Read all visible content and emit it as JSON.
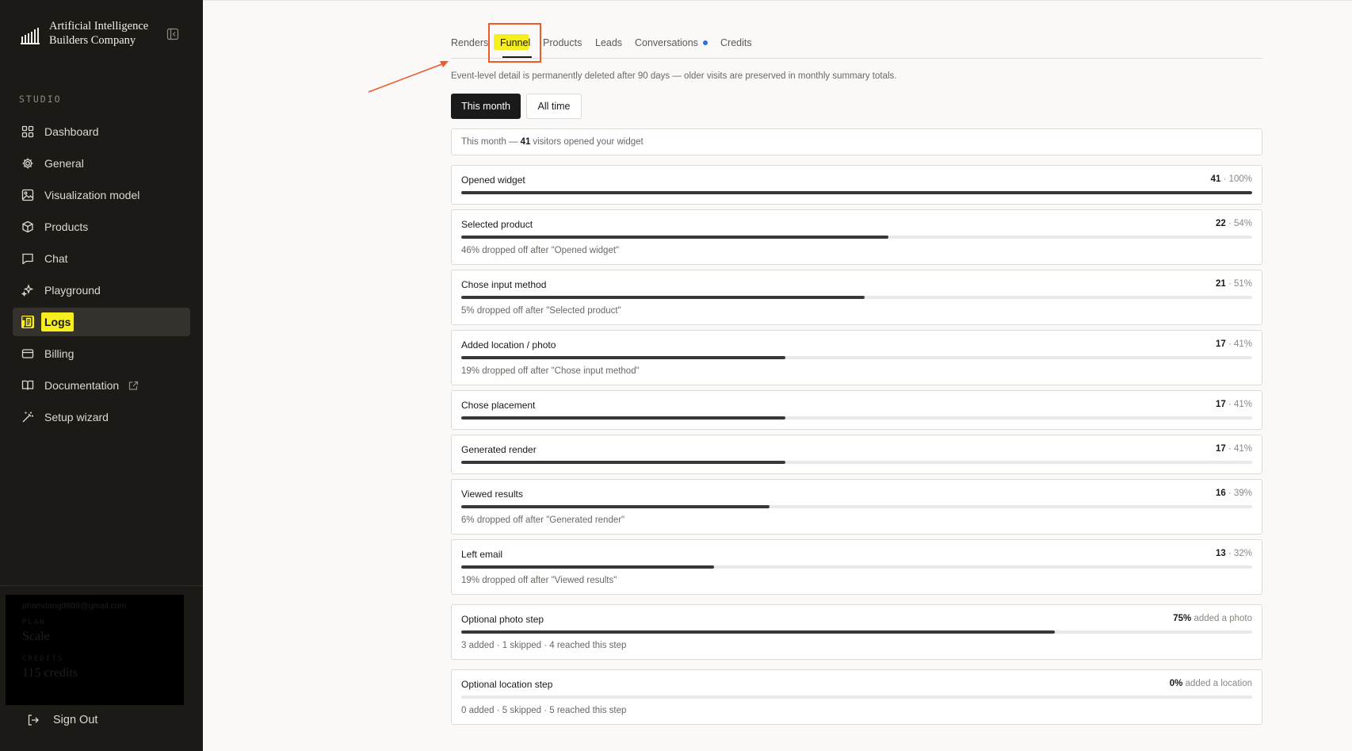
{
  "brand": {
    "line1": "Artificial Intelligence",
    "line2": "Builders Company"
  },
  "sidebar": {
    "section": "STUDIO",
    "items": [
      {
        "label": "Dashboard",
        "icon": "grid-icon"
      },
      {
        "label": "General",
        "icon": "gear-icon"
      },
      {
        "label": "Visualization model",
        "icon": "image-icon"
      },
      {
        "label": "Products",
        "icon": "box-icon"
      },
      {
        "label": "Chat",
        "icon": "chat-icon"
      },
      {
        "label": "Playground",
        "icon": "sparkle-icon"
      },
      {
        "label": "Logs",
        "icon": "scroll-icon",
        "active": true
      },
      {
        "label": "Billing",
        "icon": "card-icon"
      },
      {
        "label": "Documentation",
        "icon": "book-icon",
        "external": true
      },
      {
        "label": "Setup wizard",
        "icon": "wand-icon"
      }
    ],
    "account": {
      "email": "phamdang9809@gmail.com",
      "plan_label": "PLAN",
      "plan": "Scale",
      "credits_label": "CREDITS",
      "credits": "115 credits"
    },
    "signout": "Sign Out"
  },
  "tabs": [
    "Renders",
    "Funnel",
    "Products",
    "Leads",
    "Conversations",
    "Credits"
  ],
  "active_tab": "Funnel",
  "notice": "Event-level detail is permanently deleted after 90 days — older visits are preserved in monthly summary totals.",
  "range": {
    "this_month": "This month",
    "all_time": "All time",
    "selected": "This month"
  },
  "summary": {
    "prefix": "This month —",
    "count": "41",
    "suffix": "visitors opened your widget"
  },
  "steps": [
    {
      "title": "Opened widget",
      "count": "41",
      "pct": "· 100%",
      "fill": 1.0,
      "note": ""
    },
    {
      "title": "Selected product",
      "count": "22",
      "pct": "· 54%",
      "fill": 0.54,
      "note": "46% dropped off after \"Opened widget\""
    },
    {
      "title": "Chose input method",
      "count": "21",
      "pct": "· 51%",
      "fill": 0.51,
      "note": "5% dropped off after \"Selected product\""
    },
    {
      "title": "Added location / photo",
      "count": "17",
      "pct": "· 41%",
      "fill": 0.41,
      "note": "19% dropped off after \"Chose input method\""
    },
    {
      "title": "Chose placement",
      "count": "17",
      "pct": "· 41%",
      "fill": 0.41,
      "note": ""
    },
    {
      "title": "Generated render",
      "count": "17",
      "pct": "· 41%",
      "fill": 0.41,
      "note": ""
    },
    {
      "title": "Viewed results",
      "count": "16",
      "pct": "· 39%",
      "fill": 0.39,
      "note": "6% dropped off after \"Generated render\""
    },
    {
      "title": "Left email",
      "count": "13",
      "pct": "· 32%",
      "fill": 0.32,
      "note": "19% dropped off after \"Viewed results\""
    },
    {
      "title": "Optional photo step",
      "count": "75%",
      "pct": "added a photo",
      "fill": 0.75,
      "note": "3 added · 1 skipped · 4 reached this step"
    },
    {
      "title": "Optional location step",
      "count": "0%",
      "pct": "added a location",
      "fill": 0.0,
      "note": "0 added · 5 skipped · 5 reached this step"
    }
  ],
  "colors": {
    "sidebar_bg": "#1c1a17",
    "highlight": "#f6ee1e",
    "annotation": "#f05a28",
    "dot": "#2b6fe0"
  }
}
